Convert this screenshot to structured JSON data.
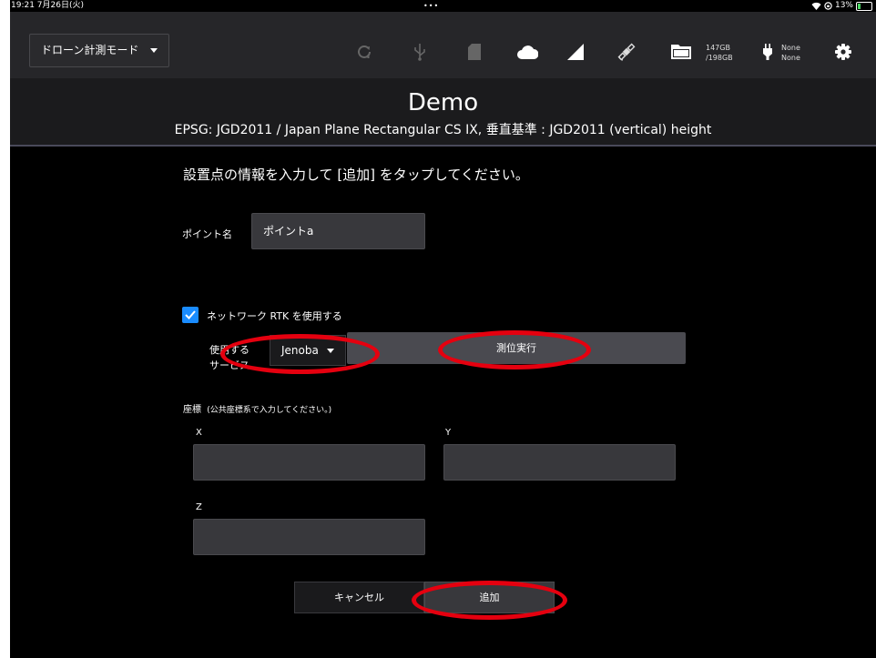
{
  "status_bar": {
    "time": "19:21  7月26日(火)",
    "dots": "•••",
    "battery": "13%"
  },
  "toolbar": {
    "mode_label": "ドローン計測モード",
    "storage_top": "147GB",
    "storage_bottom": "/198GB",
    "power_top": "None",
    "power_bottom": "None"
  },
  "header": {
    "title": "Demo",
    "subtitle": "EPSG: JGD2011 / Japan Plane Rectangular CS IX, 垂直基準 : JGD2011 (vertical) height"
  },
  "form": {
    "instruction": "設置点の情報を入力して [追加] をタップしてください。",
    "point_name_label": "ポイント名",
    "point_name_value": "ポイントa",
    "network_rtk_label": "ネットワーク RTK を使用する",
    "service_label_line1": "使用する",
    "service_label_line2": "サービス",
    "service_value": "Jenoba",
    "measure_button": "測位実行",
    "coords_label": "座標",
    "coords_note": "(公共座標系で入力してください。)",
    "x_label": "X",
    "x_value": "",
    "y_label": "Y",
    "y_value": "",
    "z_label": "Z",
    "z_value": "",
    "cancel_button": "キャンセル",
    "add_button": "追加"
  },
  "colors": {
    "background": "#000000",
    "toolbar": "#262629",
    "field": "#38383c",
    "accent": "#1a8cff",
    "annotation": "#e5000f"
  }
}
